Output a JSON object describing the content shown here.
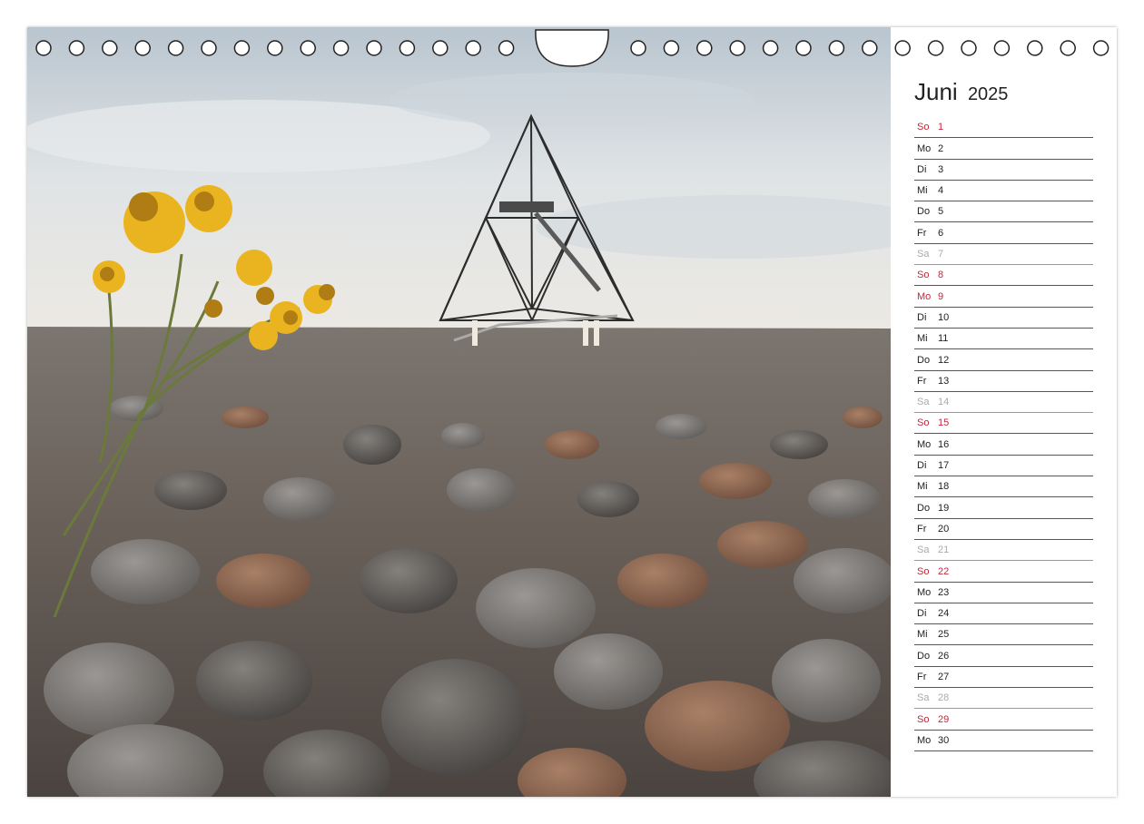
{
  "calendar": {
    "month": "Juni",
    "year": "2025",
    "days": [
      {
        "name": "So",
        "num": "1",
        "type": "sunday"
      },
      {
        "name": "Mo",
        "num": "2",
        "type": "weekday"
      },
      {
        "name": "Di",
        "num": "3",
        "type": "weekday"
      },
      {
        "name": "Mi",
        "num": "4",
        "type": "weekday"
      },
      {
        "name": "Do",
        "num": "5",
        "type": "weekday"
      },
      {
        "name": "Fr",
        "num": "6",
        "type": "weekday"
      },
      {
        "name": "Sa",
        "num": "7",
        "type": "saturday"
      },
      {
        "name": "So",
        "num": "8",
        "type": "sunday"
      },
      {
        "name": "Mo",
        "num": "9",
        "type": "holiday"
      },
      {
        "name": "Di",
        "num": "10",
        "type": "weekday"
      },
      {
        "name": "Mi",
        "num": "11",
        "type": "weekday"
      },
      {
        "name": "Do",
        "num": "12",
        "type": "weekday"
      },
      {
        "name": "Fr",
        "num": "13",
        "type": "weekday"
      },
      {
        "name": "Sa",
        "num": "14",
        "type": "saturday"
      },
      {
        "name": "So",
        "num": "15",
        "type": "sunday"
      },
      {
        "name": "Mo",
        "num": "16",
        "type": "weekday"
      },
      {
        "name": "Di",
        "num": "17",
        "type": "weekday"
      },
      {
        "name": "Mi",
        "num": "18",
        "type": "weekday"
      },
      {
        "name": "Do",
        "num": "19",
        "type": "weekday"
      },
      {
        "name": "Fr",
        "num": "20",
        "type": "weekday"
      },
      {
        "name": "Sa",
        "num": "21",
        "type": "saturday"
      },
      {
        "name": "So",
        "num": "22",
        "type": "sunday"
      },
      {
        "name": "Mo",
        "num": "23",
        "type": "weekday"
      },
      {
        "name": "Di",
        "num": "24",
        "type": "weekday"
      },
      {
        "name": "Mi",
        "num": "25",
        "type": "weekday"
      },
      {
        "name": "Do",
        "num": "26",
        "type": "weekday"
      },
      {
        "name": "Fr",
        "num": "27",
        "type": "weekday"
      },
      {
        "name": "Sa",
        "num": "28",
        "type": "saturday"
      },
      {
        "name": "So",
        "num": "29",
        "type": "sunday"
      },
      {
        "name": "Mo",
        "num": "30",
        "type": "weekday"
      }
    ]
  },
  "colors": {
    "sunday": "#c0283a",
    "saturday": "#aaaaaa",
    "weekday": "#222222"
  },
  "photo": {
    "icons": [
      "tetrahedron-tower-icon",
      "yellow-flowers-icon",
      "rock-field-icon"
    ]
  }
}
